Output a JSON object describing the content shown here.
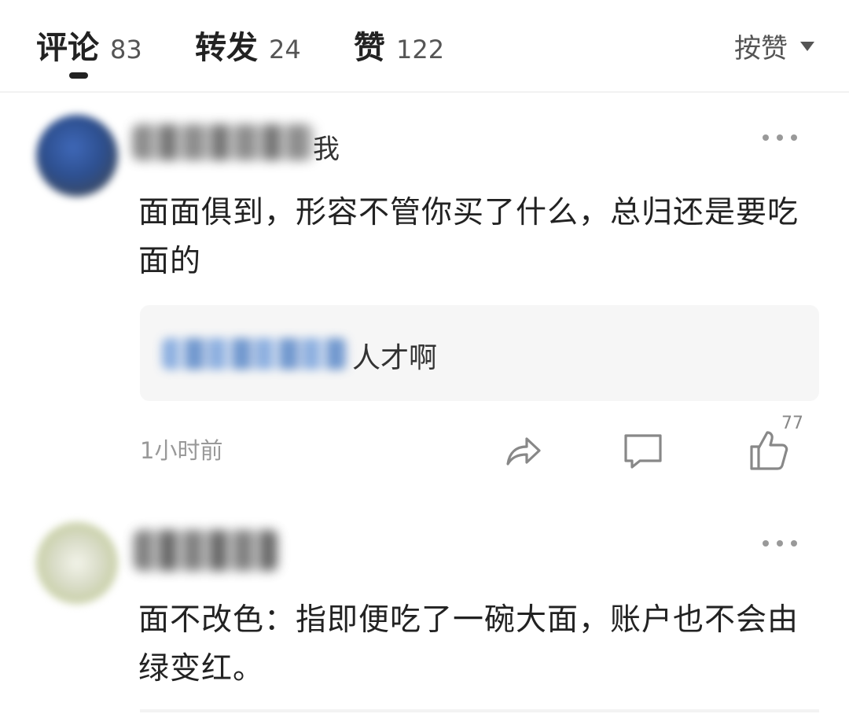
{
  "tabs": [
    {
      "label": "评论",
      "count": "83"
    },
    {
      "label": "转发",
      "count": "24"
    },
    {
      "label": "赞",
      "count": "122"
    }
  ],
  "sort": {
    "label": "按赞",
    "icon": "caret-down-icon"
  },
  "comments": [
    {
      "name_visible_suffix": "我",
      "text": "面面俱到，形容不管你买了什么，总归还是要吃面的",
      "reply": {
        "text": "人才啊"
      },
      "time": "1小时前",
      "like_count": "77",
      "actions": {
        "share_icon": "share-icon",
        "comment_icon": "comment-icon",
        "like_icon": "thumbs-up-icon"
      }
    },
    {
      "text": "面不改色：指即便吃了一碗大面，账户也不会由绿变红。"
    }
  ],
  "colors": {
    "text": "#222222",
    "muted": "#999999",
    "reply_bg": "#f6f6f6"
  }
}
